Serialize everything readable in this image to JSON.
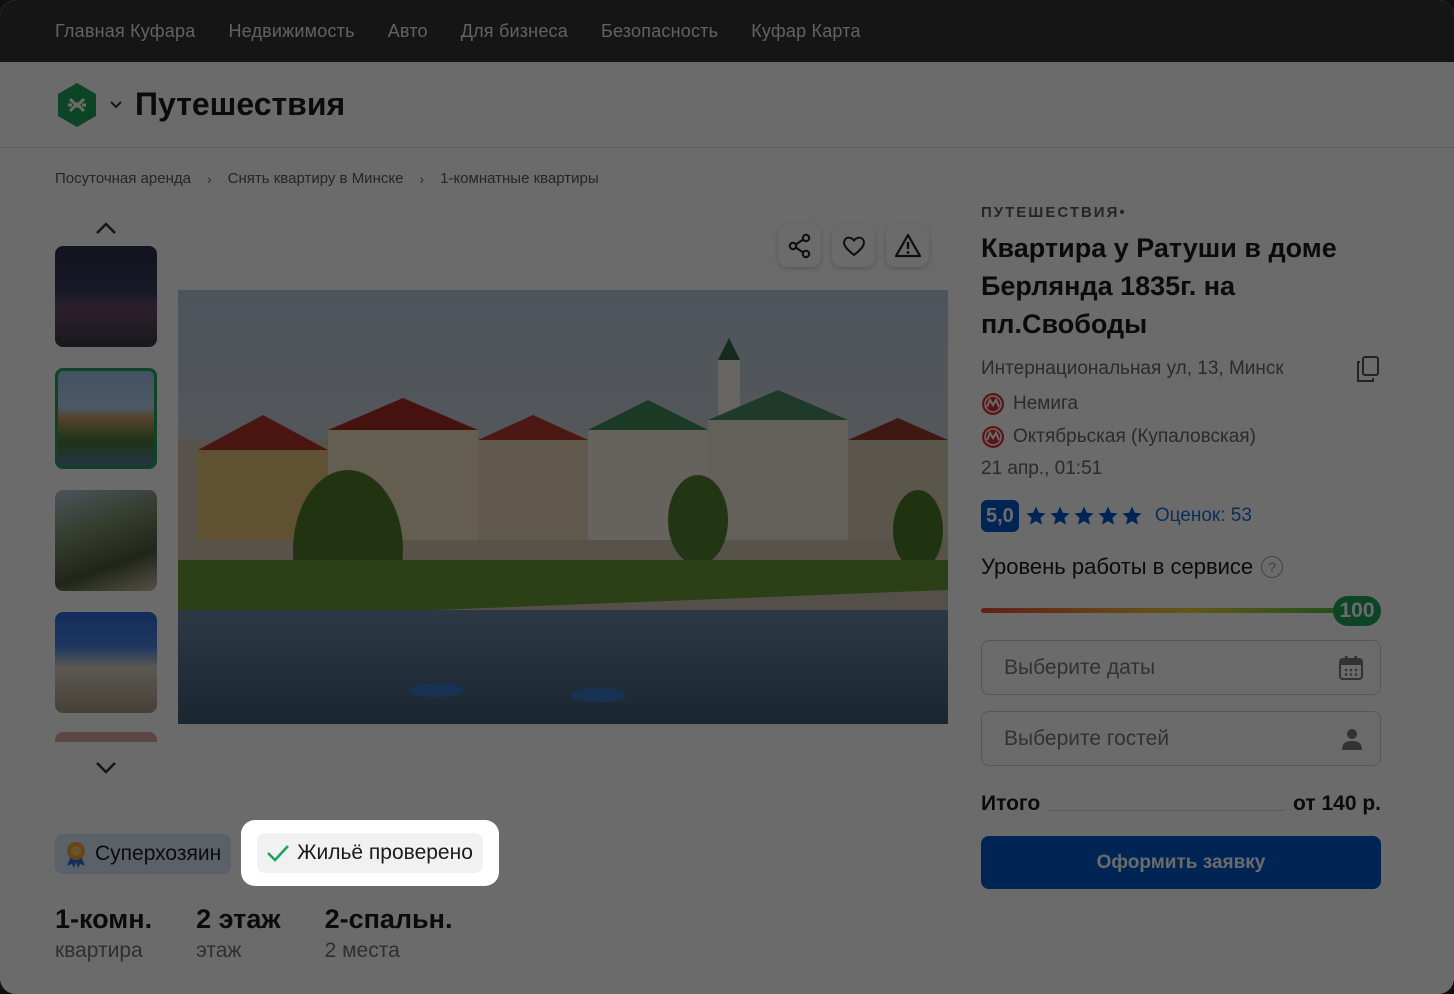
{
  "topnav": {
    "items": [
      "Главная Куфара",
      "Недвижимость",
      "Авто",
      "Для бизнеса",
      "Безопасность",
      "Куфар Карта"
    ]
  },
  "header": {
    "section_title": "Путешествия"
  },
  "breadcrumb": {
    "items": [
      "Посуточная аренда",
      "Снять квартиру в Минске",
      "1-комнатные квартиры"
    ],
    "separator": "›"
  },
  "listing": {
    "category": "ПУТЕШЕСТВИЯ•",
    "title": "Квартира у Ратуши в доме Берлянда 1835г. на пл.Свободы",
    "address": "Интернациональная ул, 13, Минск",
    "metro": [
      "Немига",
      "Октябрьская (Купаловская)"
    ],
    "date": "21 апр., 01:51",
    "rating": {
      "score": "5,0",
      "stars": 5,
      "reviews_label": "Оценок: 53"
    },
    "service": {
      "label": "Уровень работы в сервисе",
      "help": "?",
      "value": "100",
      "fraction": 1.0
    },
    "dates_placeholder": "Выберите даты",
    "guests_placeholder": "Выберите гостей",
    "total_label": "Итого",
    "total_value": "от 140 р.",
    "submit_label": "Оформить заявку"
  },
  "badges": {
    "superhost": "Суперхозяин",
    "verified": "Жильё проверено"
  },
  "specs": [
    {
      "main": "1-комн.",
      "sub": "квартира"
    },
    {
      "main": "2 этаж",
      "sub": "этаж"
    },
    {
      "main": "2-спальн.",
      "sub": "2 места"
    }
  ],
  "icons": {
    "logo": "kufar-logo-icon",
    "share": "share-icon",
    "favorite": "heart-icon",
    "report": "warning-icon",
    "copy": "copy-icon",
    "metro": "metro-icon",
    "calendar": "calendar-icon",
    "person": "person-icon",
    "check": "check-icon",
    "superhost": "award-icon"
  },
  "colors": {
    "topnav_bg": "#333333",
    "accent_blue": "#0056c7",
    "accent_green": "#1ea35a",
    "link_blue": "#1a6fd6",
    "metro_red": "#d8323a"
  }
}
